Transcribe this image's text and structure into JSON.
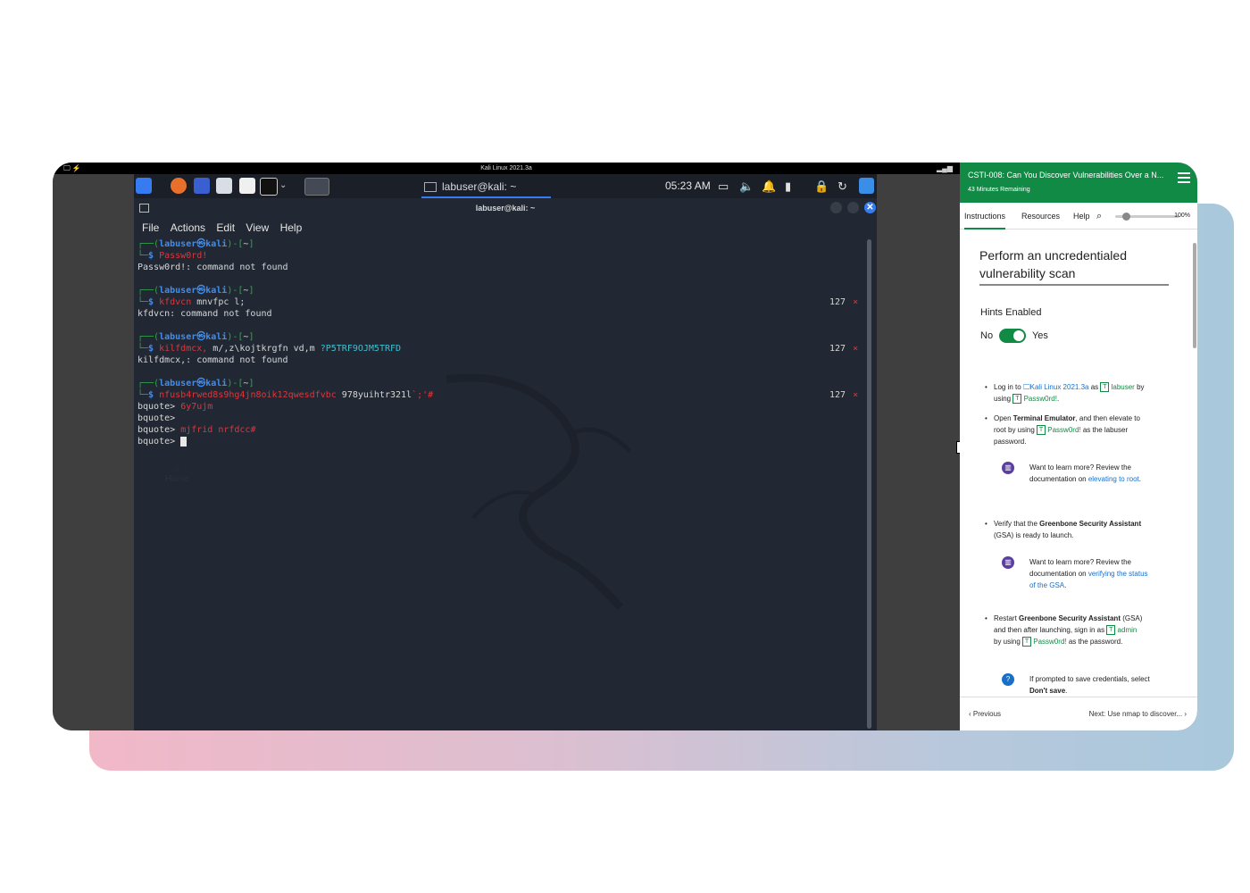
{
  "vm": {
    "window_title": "Kali Linux 2021.3a",
    "taskbar_task": "labuser@kali: ~",
    "clock": "05:23 AM",
    "terminal_title": "labuser@kali: ~",
    "menu": [
      "File",
      "Actions",
      "Edit",
      "View",
      "Help"
    ],
    "home_label": "Home",
    "prompt": {
      "user": "labuser",
      "host": "kali",
      "dir": "~"
    },
    "terminal": {
      "cmd1": "Passw0rd!",
      "out1": "Passw0rd!: command not found",
      "cmd2_bad": "kfdvcn",
      "cmd2_rest": " mnvfpc l;",
      "out2": "kfdvcn: command not found",
      "code2": "127",
      "cmd3_bad": "kilfdmcx,",
      "cmd3_rest": " m/,z\\kojtkrgfn vd,m ",
      "cmd3_cyan": "?P5TRF9OJM5TRFD",
      "out3": "kilfdmcx,: command not found",
      "code3": "127",
      "cmd4_bad": "nfusb4rwed8s9hg4jn8oik12qwesdfvbc",
      "cmd4_rest": " 978yuihtr321l",
      "cmd4_end": "`;'#",
      "code4": "127",
      "bq_prompt": "bquote>",
      "bq1": "6y7ujm",
      "bq3": "mjfrid nrfdcc#",
      "x_mark": "×"
    }
  },
  "side": {
    "title": "CSTI-008: Can You Discover Vulnerabilities Over a N...",
    "time_remaining": "43 Minutes Remaining",
    "tabs": [
      "Instructions",
      "Resources",
      "Help"
    ],
    "zoom": "100%",
    "task_heading": "Perform an uncredentialed vulnerability scan",
    "hints_label": "Hints Enabled",
    "toggle_no": "No",
    "toggle_yes": "Yes",
    "step1": {
      "a": "Log in to ",
      "vm": "Kali Linux 2021.3a",
      "b": " as ",
      "user": "labuser",
      "c": " by using ",
      "pw": "Passw0rd!",
      "d": "."
    },
    "step2": {
      "a": "Open ",
      "b": "Terminal Emulator",
      "c": ", and then elevate to root by using ",
      "pw": "Passw0rd!",
      "d": " as the labuser password."
    },
    "note1": {
      "a": "Want to learn more? Review the documentation on ",
      "link": "elevating to root",
      "b": "."
    },
    "step3": {
      "a": "Verify that the ",
      "b": "Greenbone Security Assistant",
      "c": " (GSA) is ready to launch."
    },
    "note2": {
      "a": "Want to learn more? Review the documentation on ",
      "link": "verifying the status of the GSA",
      "b": "."
    },
    "step4": {
      "a": "Restart ",
      "b": "Greenbone Security Assistant",
      "c": " (GSA) and then after launching, sign in as ",
      "user": "admin",
      "d": " by using ",
      "pw": "Passw0rd!",
      "e": " as the password."
    },
    "note3": {
      "a": "If prompted to save credentials, select ",
      "b": "Don't save",
      "c": "."
    },
    "prev": "Previous",
    "next": "Next: Use nmap to discover..."
  },
  "colors": {
    "accent_green": "#108a44",
    "kali_blue": "#367bf0",
    "error_red": "#e0353b"
  }
}
